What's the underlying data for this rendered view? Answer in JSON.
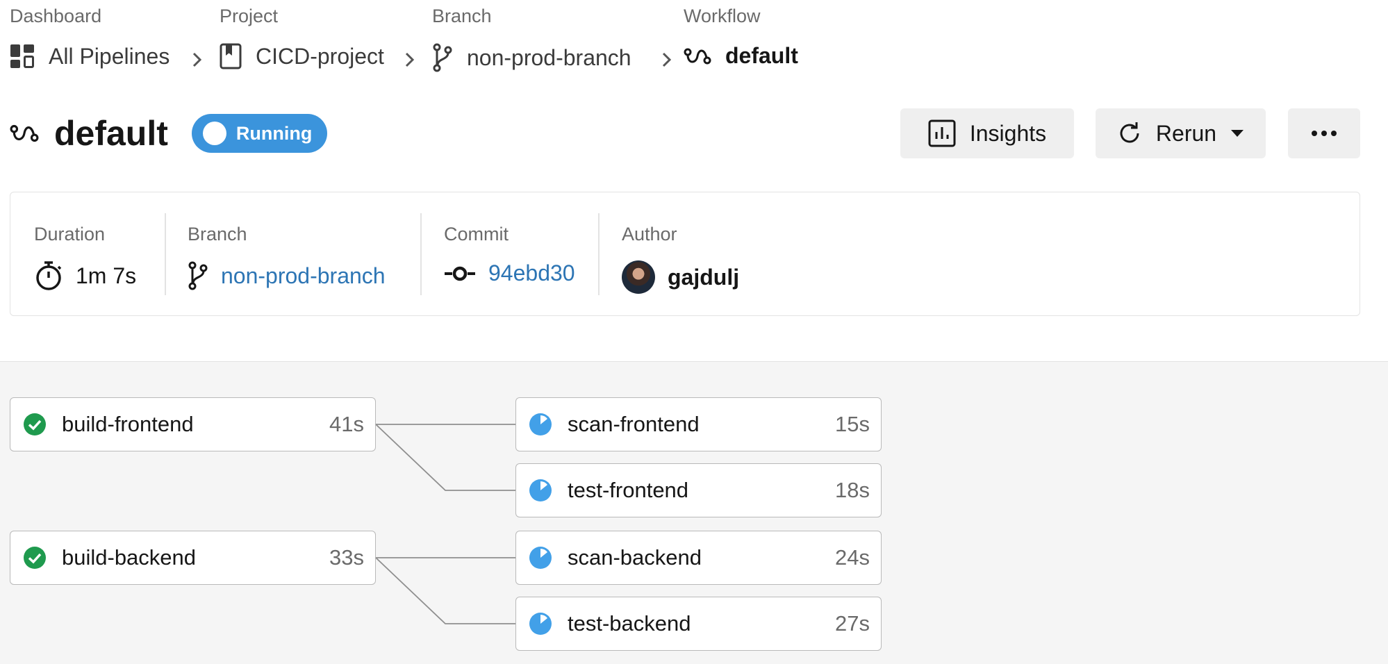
{
  "breadcrumb": {
    "dashboard": {
      "category": "Dashboard",
      "label": "All Pipelines"
    },
    "project": {
      "category": "Project",
      "label": "CICD-project"
    },
    "branch": {
      "category": "Branch",
      "label": "non-prod-branch"
    },
    "workflow": {
      "category": "Workflow",
      "label": "default"
    }
  },
  "header": {
    "title": "default",
    "status": "Running",
    "insights_label": "Insights",
    "rerun_label": "Rerun",
    "more_label": "•••"
  },
  "info": {
    "duration": {
      "label": "Duration",
      "value": "1m 7s"
    },
    "branch": {
      "label": "Branch",
      "value": "non-prod-branch"
    },
    "commit": {
      "label": "Commit",
      "value": "94ebd30"
    },
    "author": {
      "label": "Author",
      "value": "gajdulj"
    }
  },
  "jobs": [
    {
      "name": "build-frontend",
      "time": "41s",
      "status": "success"
    },
    {
      "name": "build-backend",
      "time": "33s",
      "status": "success"
    },
    {
      "name": "scan-frontend",
      "time": "15s",
      "status": "running"
    },
    {
      "name": "test-frontend",
      "time": "18s",
      "status": "running"
    },
    {
      "name": "scan-backend",
      "time": "24s",
      "status": "running"
    },
    {
      "name": "test-backend",
      "time": "27s",
      "status": "running"
    }
  ],
  "colors": {
    "running": "#3b94dc",
    "running_icon": "#42a0e8",
    "success": "#1f9a4e",
    "link": "#2d75b4",
    "graph_bg": "#f5f5f5"
  },
  "icons": [
    "dashboard-icon",
    "project-bookmark-icon",
    "branch-icon",
    "workflow-icon",
    "chevron-right-icon",
    "bar-chart-icon",
    "refresh-icon",
    "caret-down-icon",
    "more-dots-icon",
    "stopwatch-icon",
    "commit-icon",
    "check-circle-icon",
    "running-pie-icon"
  ]
}
